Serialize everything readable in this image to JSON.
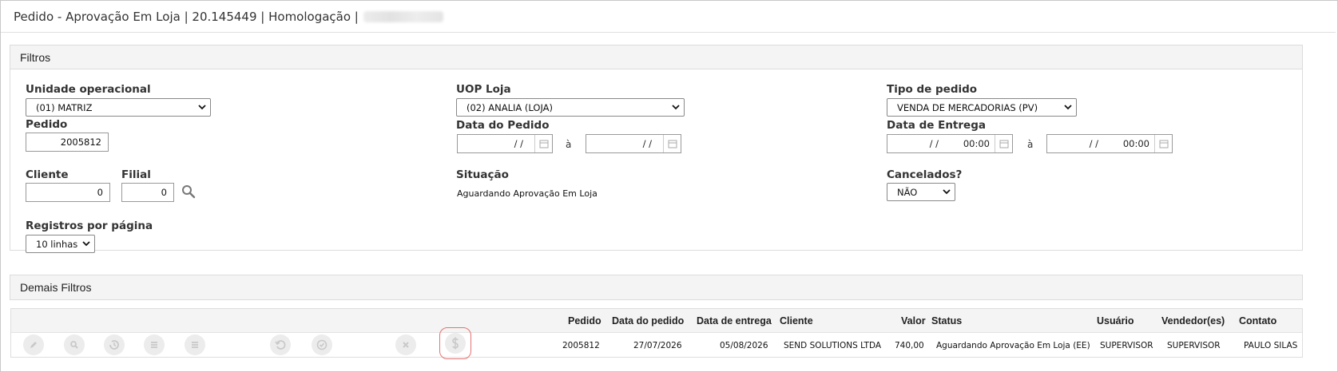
{
  "title": {
    "text": "Pedido - Aprovação Em Loja | 20.145449 | Homologação |"
  },
  "filtros": {
    "heading": "Filtros",
    "unidade_operacional": {
      "label": "Unidade operacional",
      "value": "(01) MATRIZ"
    },
    "uop_loja": {
      "label": "UOP Loja",
      "value": "(02) ANALIA (LOJA)"
    },
    "tipo_pedido": {
      "label": "Tipo de pedido",
      "value": "VENDA DE MERCADORIAS (PV)"
    },
    "pedido": {
      "label": "Pedido",
      "value": "2005812"
    },
    "data_pedido": {
      "label": "Data do Pedido",
      "from": "/ /",
      "to": "/ /",
      "sep": "à"
    },
    "data_entrega": {
      "label": "Data de Entrega",
      "from_date": "/ /",
      "from_time": "00:00",
      "to_date": "/ /",
      "to_time": "00:00",
      "sep": "à"
    },
    "cliente": {
      "label": "Cliente",
      "value": "0"
    },
    "filial": {
      "label": "Filial",
      "value": "0"
    },
    "situacao": {
      "label": "Situação",
      "value": "Aguardando Aprovação Em Loja"
    },
    "cancelados": {
      "label": "Cancelados?",
      "value": "NÃO"
    },
    "registros": {
      "label": "Registros por página",
      "value": "10 linhas"
    }
  },
  "demais_filtros": {
    "heading": "Demais Filtros"
  },
  "grid": {
    "headers": [
      "Pedido",
      "Data do pedido",
      "Data de entrega",
      "Cliente",
      "Valor",
      "Status",
      "Usuário",
      "Vendedor(es)",
      "Contato"
    ],
    "rows": [
      {
        "pedido": "2005812",
        "data_pedido": "27/07/2026",
        "data_entrega": "05/08/2026",
        "cliente": "SEND SOLUTIONS LTDA",
        "valor": "740,00",
        "status": "Aguardando Aprovação Em Loja (EE)",
        "usuario": "SUPERVISOR",
        "vendedor": "SUPERVISOR",
        "contato": "PAULO SILAS"
      }
    ],
    "actions": [
      "edit-icon",
      "search-icon",
      "history-icon",
      "list-icon",
      "list-icon",
      "undo-icon",
      "approve-icon",
      "cancel-icon",
      "dollar-icon"
    ]
  },
  "colors": {
    "accent_highlight": "#e57373",
    "icon_gray": "#c9c9c9",
    "panel_header": "#f4f4f4"
  }
}
